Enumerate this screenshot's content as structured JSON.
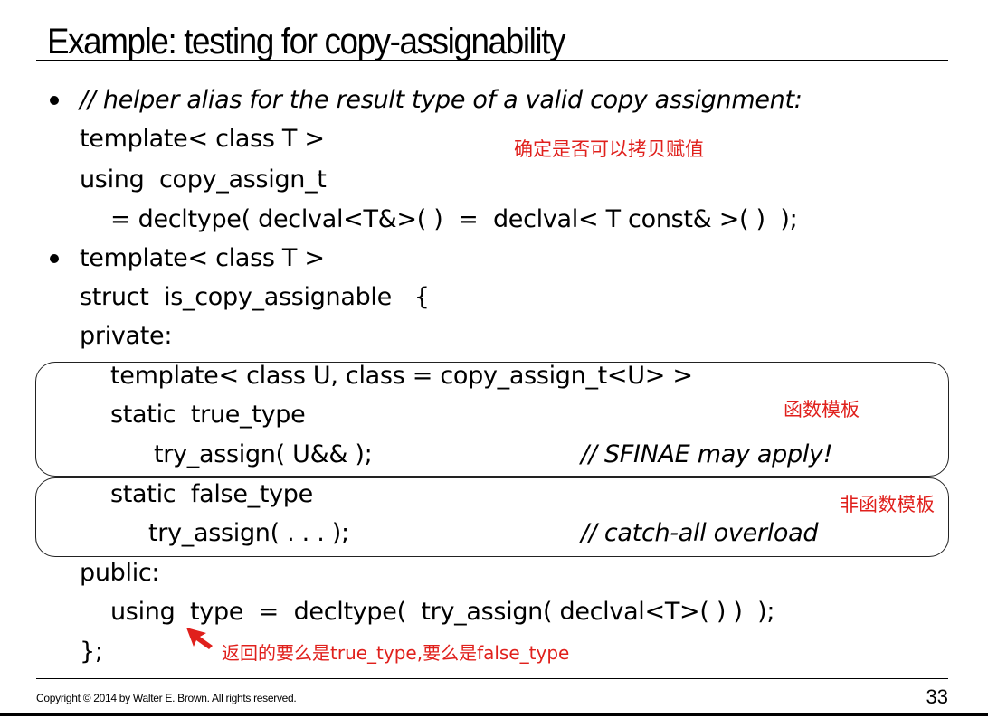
{
  "slide": {
    "title": "Example: testing for copy-assignability",
    "lines": {
      "l1": "// helper alias for the result type of a valid copy assignment:",
      "l2": "template< class T >",
      "l3": "using  copy_assign_t",
      "l4": "= decltype( declval<T&>( )  =  declval< T const& >( )  );",
      "l5": "template< class T >",
      "l6": "struct  is_copy_assignable   {",
      "l7": "private:",
      "l8": "template< class U, class = copy_assign_t<U> >",
      "l9": "static  true_type",
      "l10": "try_assign( U&& );",
      "l10c": "// SFINAE may apply!",
      "l11": "static  false_type",
      "l12": "try_assign( . . . );",
      "l12c": "// catch-all overload",
      "l13": "public:",
      "l14": "using  type  =  decltype(  try_assign( declval<T>( ) )  );",
      "l15": "};"
    }
  },
  "annotations": {
    "copy_assign_note": "确定是否可以拷贝赋值",
    "function_template_note": "函数模板",
    "non_function_template_note": "非函数模板",
    "return_note": "返回的要么是true_type,要么是false_type"
  },
  "footer": {
    "copyright": "Copyright © 2014 by Walter E. Brown.  All rights reserved.",
    "page_number": "33"
  },
  "colors": {
    "annotation": "#e0201c",
    "text": "#000000"
  }
}
